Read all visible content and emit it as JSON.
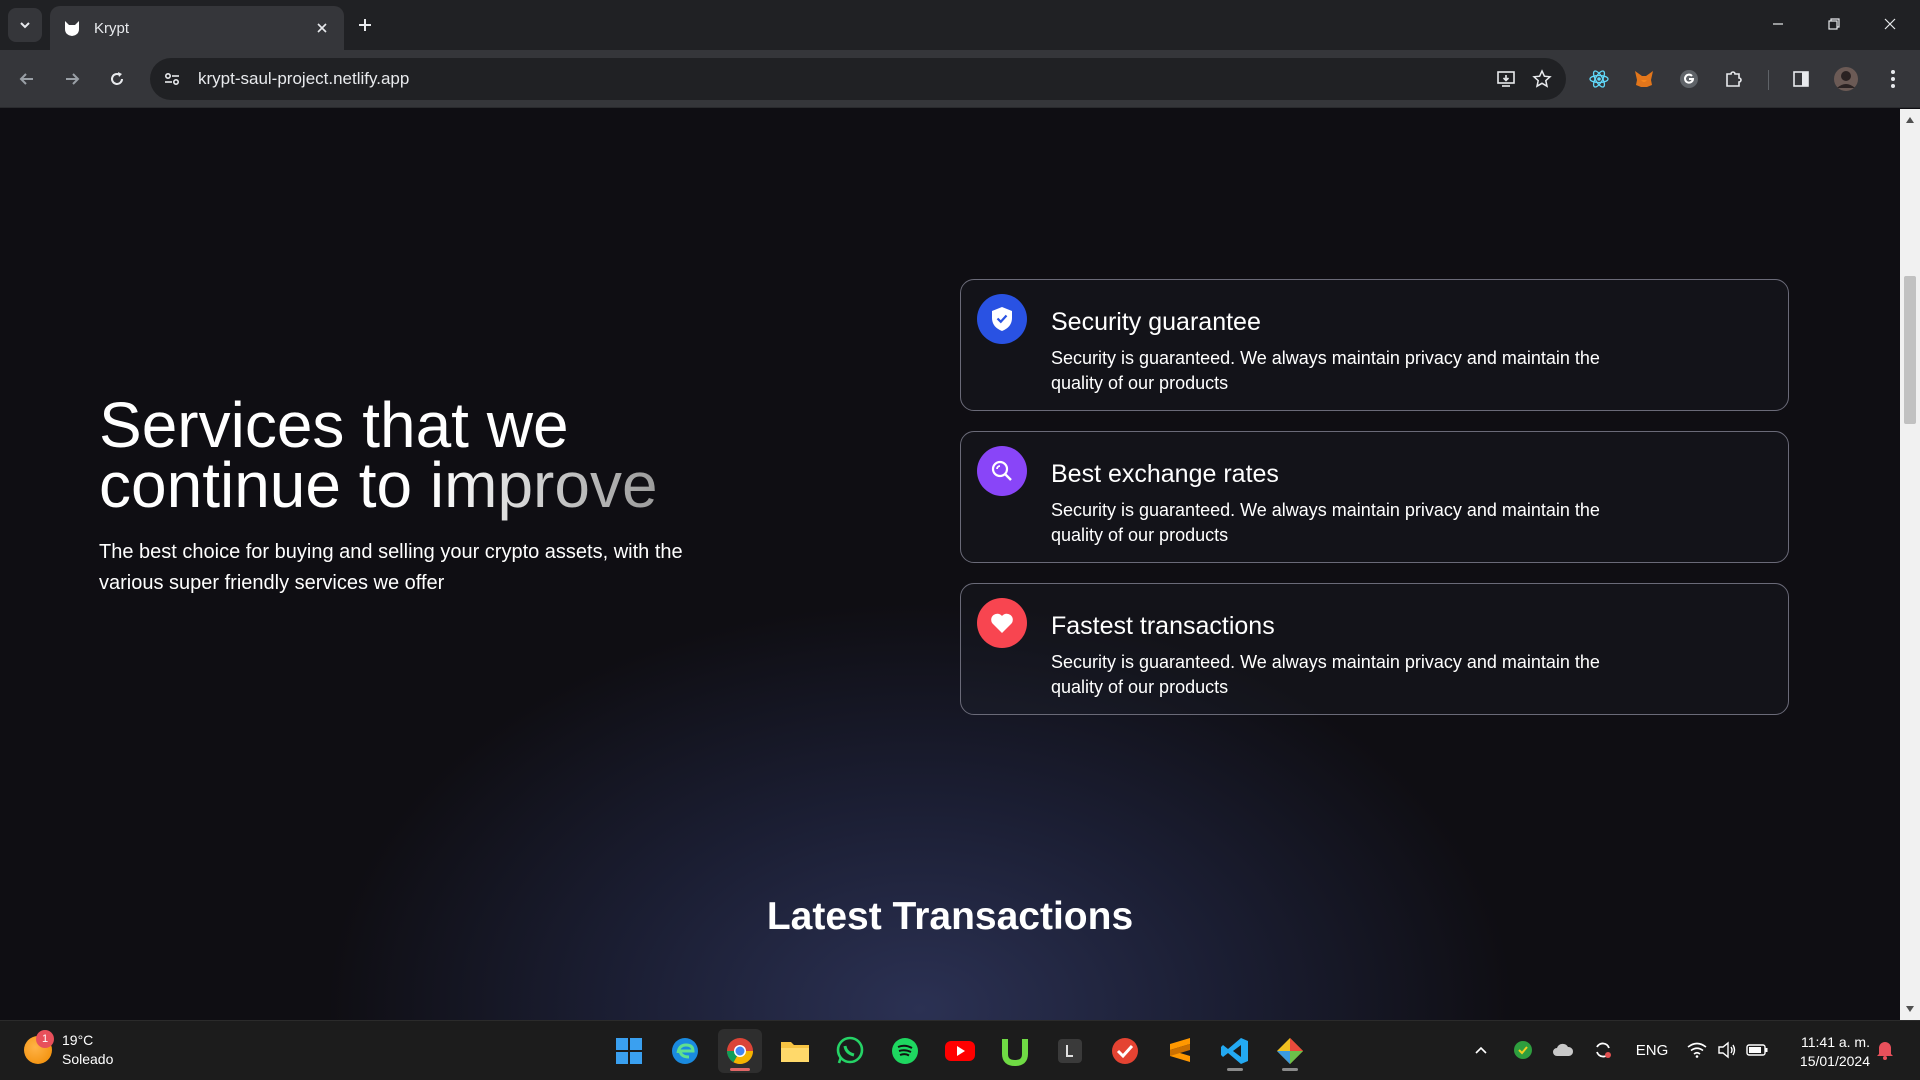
{
  "browser": {
    "tab_title": "Krypt",
    "url": "krypt-saul-project.netlify.app"
  },
  "services": {
    "heading_line1": "Services that we",
    "heading_line2_a": "continue to ",
    "heading_line2_b": "improve",
    "subtitle": "The best choice for buying and selling your crypto assets, with the various super friendly services we offer",
    "cards": [
      {
        "title": "Security guarantee",
        "description": "Security is guaranteed. We always maintain privacy and maintain the quality of our products",
        "icon": "shield-check-icon",
        "color": "#2952e3"
      },
      {
        "title": "Best exchange rates",
        "description": "Security is guaranteed. We always maintain privacy and maintain the quality of our products",
        "icon": "search-icon",
        "color": "#8945f8"
      },
      {
        "title": "Fastest transactions",
        "description": "Security is guaranteed. We always maintain privacy and maintain the quality of our products",
        "icon": "heart-icon",
        "color": "#f84550"
      }
    ]
  },
  "transactions": {
    "title": "Latest Transactions"
  },
  "taskbar": {
    "weather_temp": "19°C",
    "weather_desc": "Soleado",
    "weather_badge": "1",
    "language": "ENG",
    "time": "11:41 a. m.",
    "date": "15/01/2024"
  }
}
